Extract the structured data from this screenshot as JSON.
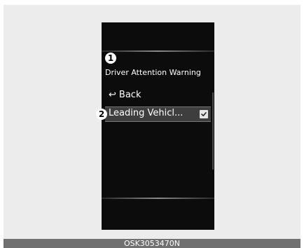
{
  "screen": {
    "callout_1": "1",
    "callout_2": "2",
    "title": "Driver Attention Warning",
    "back_icon": "↩",
    "back_label": "Back",
    "selected_item_label": "Leading Vehicl...",
    "selected_item_checked": true
  },
  "caption": {
    "code": "OSK3053470N"
  }
}
